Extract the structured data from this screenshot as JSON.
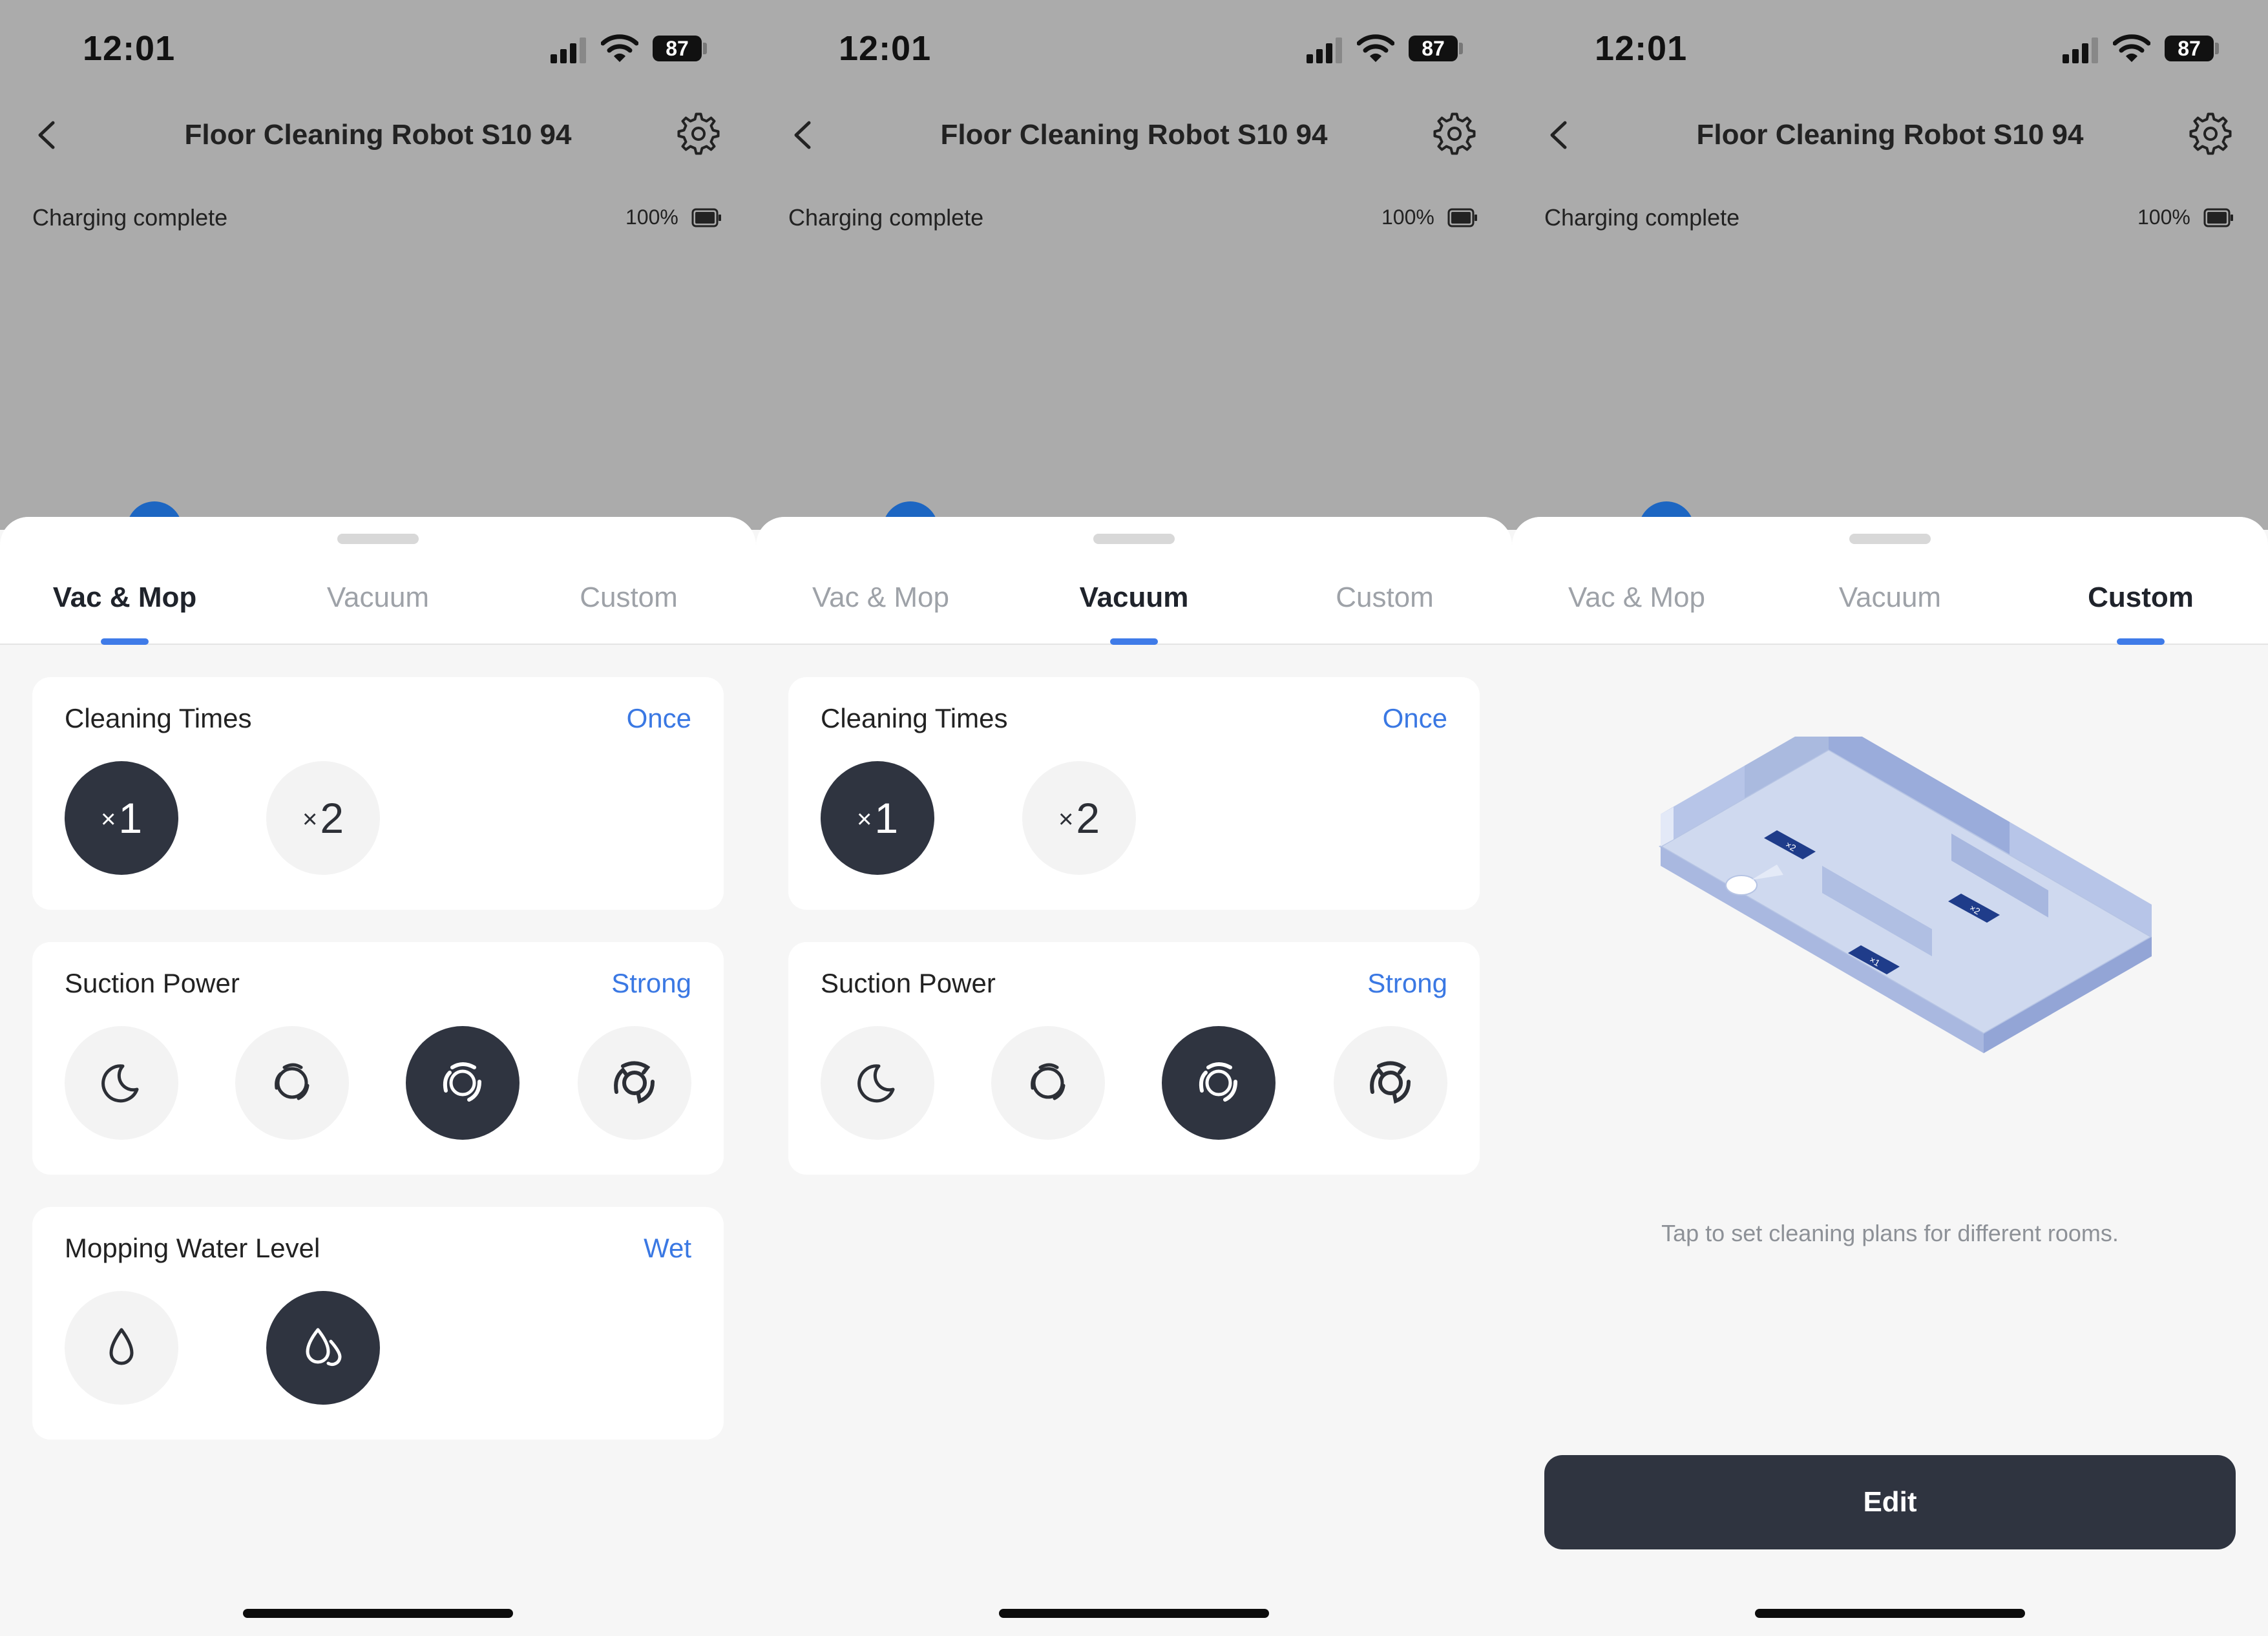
{
  "status_bar": {
    "time": "12:01",
    "battery": "87"
  },
  "header": {
    "title": "Floor Cleaning Robot S10 94"
  },
  "device": {
    "status": "Charging complete",
    "battery_percent": "100%"
  },
  "tabs": [
    "Vac & Mop",
    "Vacuum",
    "Custom"
  ],
  "cards": {
    "cleaning_times": {
      "title": "Cleaning Times",
      "value": "Once",
      "options": [
        "1",
        "2"
      ],
      "selected": "1"
    },
    "suction_power": {
      "title": "Suction Power",
      "value": "Strong",
      "options": [
        "quiet-icon",
        "standard-icon",
        "strong-icon",
        "max-icon"
      ],
      "selected": "strong-icon"
    },
    "water_level": {
      "title": "Mopping Water Level",
      "value": "Wet",
      "options": [
        "low-water-icon",
        "high-water-icon"
      ],
      "selected": "high-water-icon"
    }
  },
  "custom": {
    "hint": "Tap to set cleaning plans for different rooms.",
    "edit_label": "Edit",
    "room_tags": [
      "×2",
      "×2",
      "×1"
    ]
  },
  "colors": {
    "accent": "#3a78e3",
    "selected": "#2f3440",
    "header_bg": "#ababab",
    "dot": "#1d66c2"
  },
  "panels": [
    {
      "active_tab": "Vac & Mop"
    },
    {
      "active_tab": "Vacuum"
    },
    {
      "active_tab": "Custom"
    }
  ]
}
